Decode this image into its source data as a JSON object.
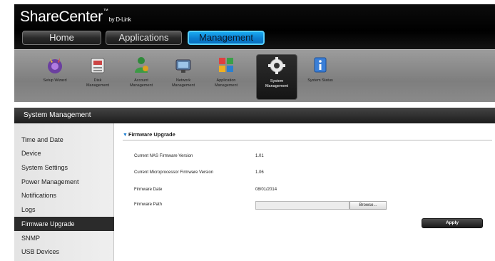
{
  "header": {
    "logo_text": "ShareCenter",
    "logo_tm": "™",
    "logo_by": "by D-Link",
    "tabs": [
      {
        "label": "Home"
      },
      {
        "label": "Applications"
      },
      {
        "label": "Management"
      }
    ]
  },
  "toolbar": {
    "items": [
      {
        "label_line1": "Setup Wizard",
        "label_line2": "",
        "icon": "wizard-icon"
      },
      {
        "label_line1": "Disk",
        "label_line2": "Management",
        "icon": "disk-icon"
      },
      {
        "label_line1": "Account",
        "label_line2": "Management",
        "icon": "account-icon"
      },
      {
        "label_line1": "Network",
        "label_line2": "Management",
        "icon": "network-icon"
      },
      {
        "label_line1": "Application",
        "label_line2": "Management",
        "icon": "application-icon"
      },
      {
        "label_line1": "System",
        "label_line2": "Management",
        "icon": "system-gear-icon"
      },
      {
        "label_line1": "System Status",
        "label_line2": "",
        "icon": "info-icon"
      }
    ]
  },
  "section_title": "System Management",
  "sidebar": {
    "items": [
      {
        "label": "Time and Date"
      },
      {
        "label": "Device"
      },
      {
        "label": "System Settings"
      },
      {
        "label": "Power Management"
      },
      {
        "label": "Notifications"
      },
      {
        "label": "Logs"
      },
      {
        "label": "Firmware Upgrade"
      },
      {
        "label": "SNMP"
      },
      {
        "label": "USB Devices"
      }
    ],
    "active_index": 6
  },
  "firmware": {
    "title": "Firmware Upgrade",
    "nas_label": "Current NAS Firmware Version",
    "nas_value": "1.01",
    "micro_label": "Current Microprocessor Firmware Version",
    "micro_value": "1.06",
    "date_label": "Firmware Date",
    "date_value": "08/01/2014",
    "path_label": "Firmware Path",
    "path_value": "",
    "browse_label": "Browse...",
    "apply_label": "Apply"
  },
  "colors": {
    "active_tab": "#0b7fd0",
    "accent_triangle": "#1d7fd2"
  }
}
